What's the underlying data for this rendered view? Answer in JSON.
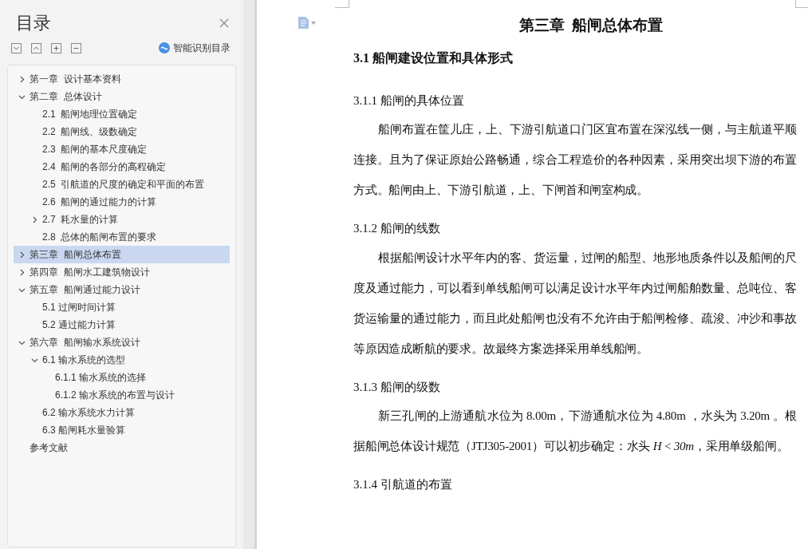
{
  "sidebar": {
    "title": "目录",
    "smart_toc_label": "智能识别目录",
    "items": [
      {
        "label": "第一章  设计基本资料",
        "expanded": false,
        "selected": false
      },
      {
        "label": "第二章  总体设计",
        "expanded": true,
        "selected": false,
        "children": [
          {
            "label": "2.1  船闸地理位置确定",
            "selected": false
          },
          {
            "label": "2.2  船闸线、级数确定",
            "selected": false
          },
          {
            "label": "2.3  船闸的基本尺度确定",
            "selected": false
          },
          {
            "label": "2.4  船闸的各部分的高程确定",
            "selected": false
          },
          {
            "label": "2.5  引航道的尺度的确定和平面的布置",
            "selected": false
          },
          {
            "label": "2.6  船闸的通过能力的计算",
            "selected": false
          },
          {
            "label": "2.7  耗水量的计算",
            "expanded": false,
            "selected": false
          },
          {
            "label": "2.8  总体的船闸布置的要求",
            "selected": false
          }
        ]
      },
      {
        "label": "第三章  船闸总体布置",
        "expanded": false,
        "selected": true
      },
      {
        "label": "第四章  船闸水工建筑物设计",
        "expanded": false,
        "selected": false
      },
      {
        "label": "第五章  船闸通过能力设计",
        "expanded": true,
        "selected": false,
        "children": [
          {
            "label": "5.1 过闸时间计算",
            "selected": false
          },
          {
            "label": "5.2 通过能力计算",
            "selected": false
          }
        ]
      },
      {
        "label": "第六章  船闸输水系统设计",
        "expanded": true,
        "selected": false,
        "children": [
          {
            "label": "6.1 输水系统的选型",
            "expanded": true,
            "selected": false,
            "children": [
              {
                "label": "6.1.1 输水系统的选择",
                "selected": false
              },
              {
                "label": "6.1.2 输水系统的布置与设计",
                "selected": false
              }
            ]
          },
          {
            "label": "6.2 输水系统水力计算",
            "selected": false
          },
          {
            "label": "6.3 船闸耗水量验算",
            "selected": false
          }
        ]
      },
      {
        "label": "参考文献",
        "selected": false
      }
    ]
  },
  "document": {
    "blocks": [
      {
        "kind": "chapter",
        "text": "第三章  船闸总体布置"
      },
      {
        "kind": "section",
        "text": "3.1 船闸建设位置和具体形式"
      },
      {
        "kind": "subsection",
        "text": "3.1.1 船闸的具体位置"
      },
      {
        "kind": "paragraph",
        "text": "船闸布置在筐儿庄，上、下游引航道口门区宜布置在深泓线一侧，与主航道平顺连接。且为了保证原始公路畅通，综合工程造价的各种因素，采用突出坝下游的布置方式。船闸由上、下游引航道，上、下闸首和闸室构成。"
      },
      {
        "kind": "subsection",
        "text": "3.1.2 船闸的线数"
      },
      {
        "kind": "paragraph",
        "text": "根据船闸设计水平年内的客、货运量，过闸的船型、地形地质条件以及船闸的尺度及通过能力，可以看到单线船闸可以满足设计水平年内过闸船舶数量、总吨位、客货运输量的通过能力，而且此处船闸也没有不允许由于船闸检修、疏浚、冲沙和事故等原因造成断航的要求。故最终方案选择采用单线船闸。"
      },
      {
        "kind": "subsection",
        "text": "3.1.3 船闸的级数"
      },
      {
        "kind": "paragraph",
        "text": "新三孔闸的上游通航水位为 8.00m，下游通航水位为 4.80m ，水头为 3.20m 。根据船闸总体设计规范（JTJ305-2001）可以初步确定：水头 *H* < *30m*，采用单级船闸。"
      },
      {
        "kind": "subsection",
        "text": "3.1.4 引航道的布置"
      }
    ]
  }
}
